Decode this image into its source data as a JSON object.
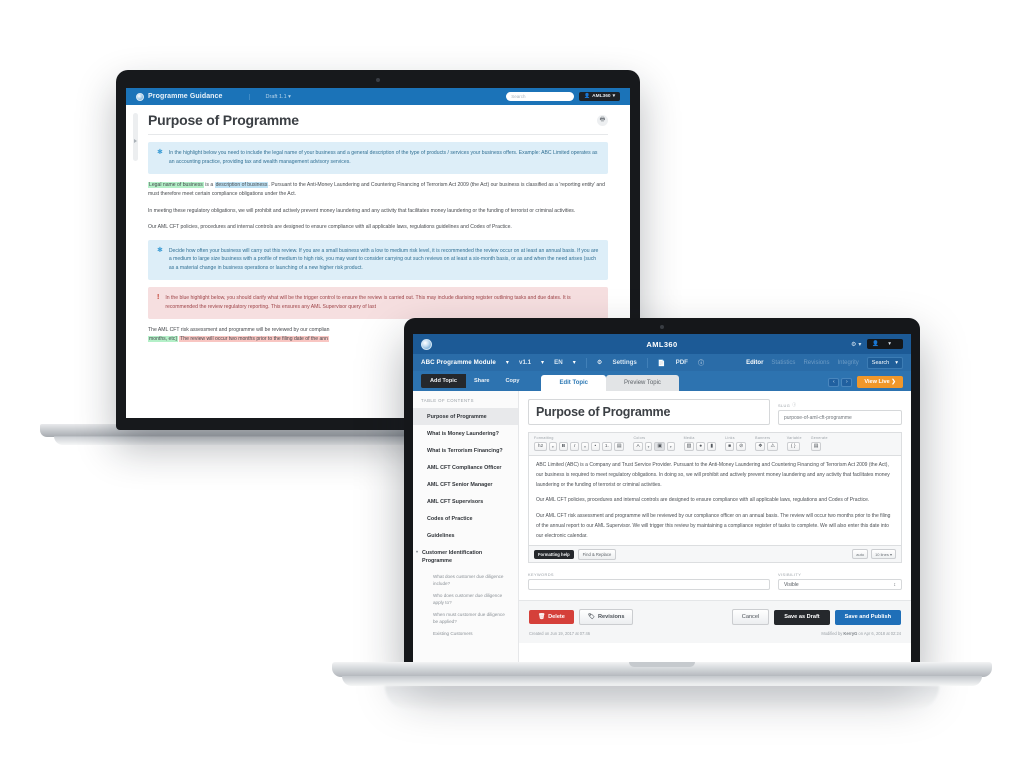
{
  "back_window": {
    "topbar": {
      "brand": "Programme Guidance",
      "brand_icon": "globe-icon",
      "draft_label": "Draft 1.1",
      "draft_caret": "▾",
      "search_placeholder": "Search",
      "user_label": "AML360",
      "user_icon": "person-icon",
      "user_caret": "▾"
    },
    "page_title": "Purpose of Programme",
    "print_icon": "print-icon",
    "notes": [
      {
        "type": "blue",
        "icon": "asterisk-icon",
        "text": "In the highlight below you need to include the legal name of your business and a general description of the type of products / services your business offers. Example: ABC Limited operates as an accounting practice, providing tax and wealth management advisory services."
      },
      {
        "type": "blue",
        "icon": "asterisk-icon",
        "text": "Decide how often your business will carry out this review. If you are a small business with a low to medium risk level, it is recommended the review occur on at least an annual basis. If you are a medium to large size business with a profile of medium to high risk, you may want to consider carrying out such reviews on at least a six-month basis, or as and when the need arises (such as a material change in business operations or launching of a new higher risk product."
      },
      {
        "type": "red",
        "icon": "exclamation-icon",
        "text": "In the blue highlight below, you should clarify what will be the trigger control to ensure the review is carried out. This may include diarising register outlining tasks and due dates. It is recommended the review regulatory reporting. This ensures any AML Supervisor query of last"
      }
    ],
    "paragraph_1": {
      "hl_green": "Legal name of business",
      "mid": " is a ",
      "hl_blue": "description of business",
      "rest": ". Pursuant to the Anti-Money Laundering and Countering Financing of Terrorism Act 2009 (the Act) our business is classified as a 'reporting entity' and must therefore meet certain compliance obligations under the Act."
    },
    "paragraph_2": "In meeting these regulatory obligations, we will prohibit and actively prevent money laundering and any activity that facilitates money laundering or the funding of terrorist or criminal activities.",
    "paragraph_3": "Our AML CFT policies, procedures and internal controls are designed to ensure compliance with all applicable laws, regulations guidelines and Codes of Practice.",
    "paragraph_4": {
      "lead": "The AML CFT risk assessment and programme will be reviewed by our complian",
      "hl_green": "months, etc]",
      "hl_red": "The review will occur two months prior to the filing date of the ann"
    }
  },
  "front_window": {
    "topbar": {
      "logo_icon": "globe-icon",
      "app_title": "AML360",
      "gear_icon": "gear-icon",
      "gear_caret": "▾",
      "user_icon": "person-icon",
      "user_caret": "▾"
    },
    "navbar": {
      "module": "ABC Programme Module",
      "module_caret": "▾",
      "version": "v1.1",
      "version_caret": "▾",
      "language": "EN",
      "language_caret": "▾",
      "settings": "Settings",
      "settings_icon": "gear-icon",
      "pdf": "PDF",
      "pdf_icon": "file-icon",
      "pdf_badge_icon": "info-icon",
      "links": [
        "Editor",
        "Statistics",
        "Revisions",
        "Integrity"
      ],
      "active_link": "Editor",
      "search_label": "Search",
      "search_caret": "▾"
    },
    "actionbar": {
      "add_topic": "Add Topic",
      "share": "Share",
      "copy": "Copy",
      "tabs": [
        "Edit Topic",
        "Preview Topic"
      ],
      "active_tab": "Edit Topic",
      "prev_icon": "‹",
      "next_icon": "›",
      "view_live": "View Live ❯"
    },
    "sidebar": {
      "heading": "TABLE OF CONTENTS",
      "items": [
        {
          "label": "Purpose of Programme",
          "active": true,
          "level": 1
        },
        {
          "label": "What is Money Laundering?",
          "active": false,
          "level": 1
        },
        {
          "label": "What is Terrorism Financing?",
          "active": false,
          "level": 1
        },
        {
          "label": "AML CFT Compliance Officer",
          "active": false,
          "level": 1
        },
        {
          "label": "AML CFT Senior Manager",
          "active": false,
          "level": 1
        },
        {
          "label": "AML CFT Supervisors",
          "active": false,
          "level": 1
        },
        {
          "label": "Codes of Practice",
          "active": false,
          "level": 1
        },
        {
          "label": "Guidelines",
          "active": false,
          "level": 1
        },
        {
          "label": "Customer Identification Programme",
          "active": false,
          "level": 1,
          "group": true
        },
        {
          "label": "What does customer due diligence include?",
          "active": false,
          "level": 2
        },
        {
          "label": "Who does customer due diligence apply to?",
          "active": false,
          "level": 2
        },
        {
          "label": "When must customer due diligence be applied?",
          "active": false,
          "level": 2
        },
        {
          "label": "Existing Customers",
          "active": false,
          "level": 2
        }
      ]
    },
    "editor": {
      "topic_title": "Purpose of Programme",
      "slug_label": "SLUG",
      "slug_icon": "info-icon",
      "slug_value": "purpose-of-aml-cft-programme",
      "toolbar_groups": [
        {
          "caption": "Formatting",
          "buttons": [
            "h2",
            "▾",
            "B",
            "I",
            "▾",
            "•",
            "1.",
            "▤"
          ]
        },
        {
          "caption": "Colors",
          "buttons": [
            "A",
            "▾",
            "▣",
            "▾"
          ]
        },
        {
          "caption": "Media",
          "buttons": [
            "▧",
            "●",
            "▮"
          ]
        },
        {
          "caption": "Links",
          "buttons": [
            "■",
            "⊘"
          ]
        },
        {
          "caption": "Banners",
          "buttons": [
            "❖",
            "⚠"
          ]
        },
        {
          "caption": "Variable",
          "buttons": [
            "{ }"
          ]
        },
        {
          "caption": "Generate",
          "buttons": [
            "▤"
          ]
        }
      ],
      "body_paragraphs": [
        "ABC Limited (ABC) is a Company and Trust Service Provider. Pursuant to the Anti-Money Laundering and Countering Financing of Terrorism Act 2009 (the Act), our business is required to meet regulatory obligations.  In doing so, we will prohibit and actively prevent money laundering and any activity that facilitates money laundering or the funding of terrorist or criminal activities.",
        "Our AML CFT policies, procedures and internal controls are designed to ensure compliance with all applicable laws, regulations and Codes of Practice.",
        "Our AML CFT risk assessment and programme will be reviewed by our compliance officer on an annual basis. The review will occur two months prior to the filing of the annual report to our AML Supervisor. We will trigger this review by maintaining a compliance register of tasks to complete.  We will also enter this date into our electronic calendar."
      ],
      "formatting_help": "Formatting help",
      "find_replace": "Find & Replace",
      "auto_label": "auto",
      "lines_label": "10 lines",
      "lines_caret": "▾"
    },
    "meta": {
      "keywords_label": "KEYWORDS",
      "keywords_value": "",
      "visibility_label": "VISIBILITY",
      "visibility_value": "Visible",
      "visibility_caret": "↕"
    },
    "footer": {
      "delete": "Delete",
      "delete_icon": "trash-icon",
      "revisions": "Revisions",
      "revisions_icon": "tag-icon",
      "cancel": "Cancel",
      "save_draft": "Save as Draft",
      "save_publish": "Save and Publish",
      "created_prefix": "Created on ",
      "created_value": "Jun 19, 2017 at 07:46",
      "modified_prefix": "Modified by ",
      "modified_user": "KerryG",
      "modified_suffix": " on Apr 6, 2018 at 02:24"
    }
  },
  "colors": {
    "back_topbar": "#1b73b8",
    "front_topbar": "#1c5a96",
    "front_navbar": "#2a6ca8",
    "front_actionbar": "#2d73b0",
    "accent_orange": "#f0972a",
    "publish_blue": "#1f6fb8",
    "delete_red": "#d5403a",
    "note_blue_bg": "#ddeef8",
    "note_red_bg": "#f6dfe0",
    "highlight_green": "#b4f0c8",
    "highlight_blue": "#bfe3f5",
    "highlight_red": "#f9c6c2"
  }
}
